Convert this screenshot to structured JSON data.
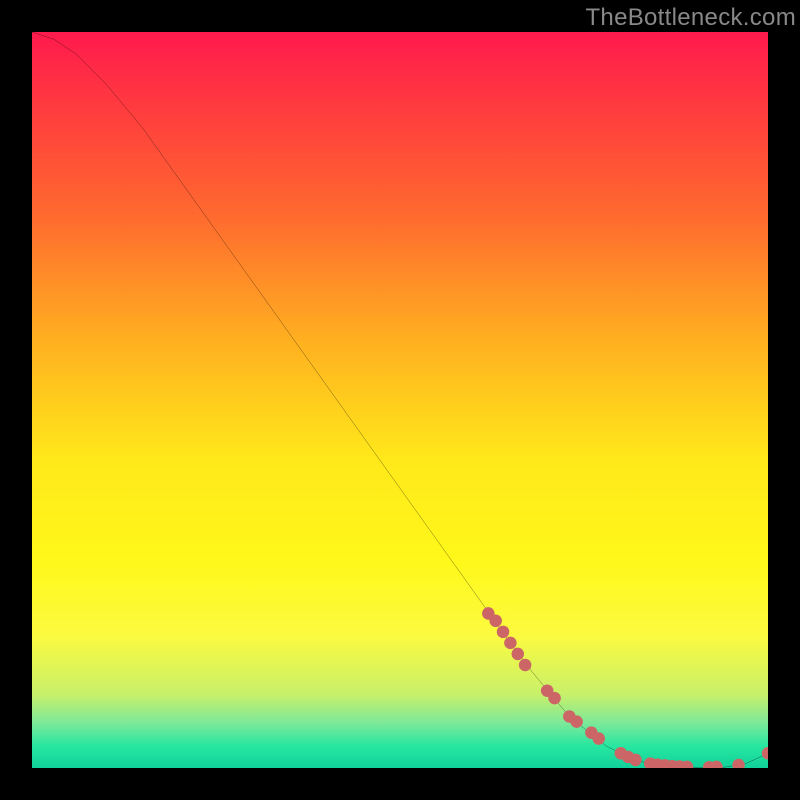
{
  "watermark": "TheBottleneck.com",
  "chart_data": {
    "type": "line",
    "title": "",
    "xlabel": "",
    "ylabel": "",
    "xlim": [
      0,
      100
    ],
    "ylim": [
      0,
      100
    ],
    "curve": {
      "x": [
        0,
        3,
        6,
        10,
        15,
        20,
        25,
        30,
        35,
        40,
        45,
        50,
        55,
        60,
        65,
        68,
        73,
        78,
        82,
        86,
        90,
        94,
        97,
        100
      ],
      "y": [
        100,
        99,
        97,
        93,
        87,
        80,
        73,
        66,
        59,
        52,
        45,
        38,
        31,
        24,
        17,
        13,
        7,
        3,
        1,
        0.3,
        0.1,
        0.1,
        0.6,
        2
      ]
    },
    "markers": {
      "name": "highlight-points",
      "color": "#cc6666",
      "points": [
        {
          "x": 62,
          "y": 21
        },
        {
          "x": 63,
          "y": 20
        },
        {
          "x": 64,
          "y": 18.5
        },
        {
          "x": 65,
          "y": 17
        },
        {
          "x": 66,
          "y": 15.5
        },
        {
          "x": 67,
          "y": 14
        },
        {
          "x": 70,
          "y": 10.5
        },
        {
          "x": 71,
          "y": 9.5
        },
        {
          "x": 73,
          "y": 7
        },
        {
          "x": 74,
          "y": 6.3
        },
        {
          "x": 76,
          "y": 4.8
        },
        {
          "x": 77,
          "y": 4
        },
        {
          "x": 80,
          "y": 2
        },
        {
          "x": 81,
          "y": 1.5
        },
        {
          "x": 82,
          "y": 1.1
        },
        {
          "x": 84,
          "y": 0.6
        },
        {
          "x": 85,
          "y": 0.45
        },
        {
          "x": 86,
          "y": 0.35
        },
        {
          "x": 87,
          "y": 0.25
        },
        {
          "x": 88,
          "y": 0.2
        },
        {
          "x": 89,
          "y": 0.15
        },
        {
          "x": 92,
          "y": 0.1
        },
        {
          "x": 93,
          "y": 0.15
        },
        {
          "x": 96,
          "y": 0.4
        },
        {
          "x": 100,
          "y": 2
        }
      ]
    }
  }
}
